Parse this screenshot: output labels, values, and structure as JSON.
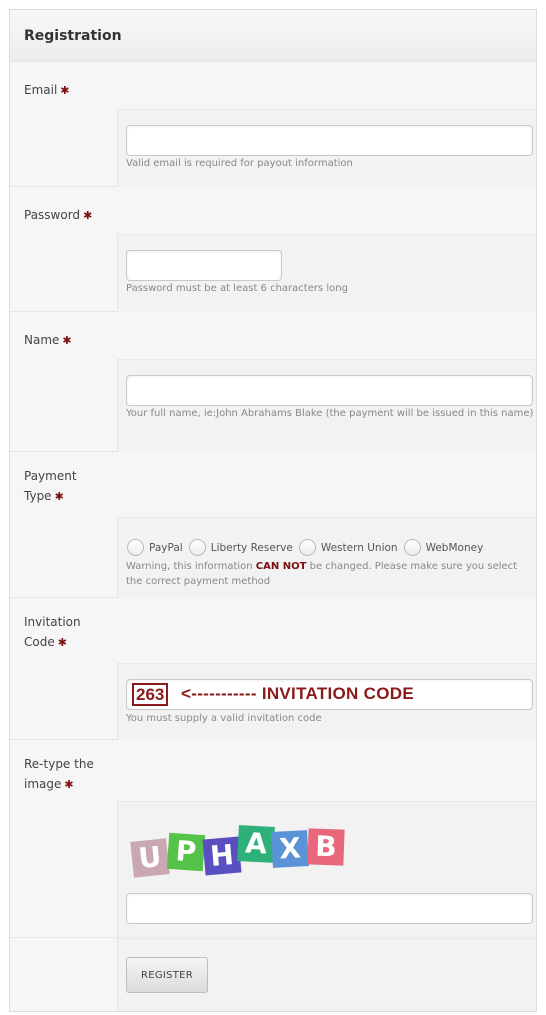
{
  "form": {
    "title": "Registration"
  },
  "fields": {
    "email": {
      "label": "Email",
      "hint": "Valid email is required for payout information",
      "value": ""
    },
    "password": {
      "label": "Password",
      "hint": "Password must be at least 6 characters long",
      "value": ""
    },
    "name": {
      "label": "Name",
      "hint": "Your full name, ie:John Abrahams Blake (the payment will be issued in this name)",
      "value": ""
    },
    "payment": {
      "label_line1": "Payment",
      "label_line2": "Type",
      "options": [
        "PayPal",
        "Liberty Reserve",
        "Western Union",
        "WebMoney"
      ],
      "warning_pre": "Warning, this information ",
      "warning_bold": "CAN NOT",
      "warning_post": " be changed. Please make sure you select the correct payment method"
    },
    "invitation": {
      "label_line1": "Invitation",
      "label_line2": "Code",
      "value_code": "263",
      "value_annotation": "<----------- INVITATION CODE",
      "hint": "You must supply a valid invitation code"
    },
    "captcha": {
      "label_line1": "Re-type the",
      "label_line2": "image",
      "letters": [
        {
          "char": "U",
          "color": "#c9a8b4"
        },
        {
          "char": "P",
          "color": "#55c24a"
        },
        {
          "char": "H",
          "color": "#5a4fc0"
        },
        {
          "char": "A",
          "color": "#2fb07a"
        },
        {
          "char": "X",
          "color": "#5a93d8"
        },
        {
          "char": "B",
          "color": "#e8677a"
        }
      ],
      "value": ""
    }
  },
  "submit": {
    "label": "REGISTER"
  },
  "required_mark": "✱"
}
